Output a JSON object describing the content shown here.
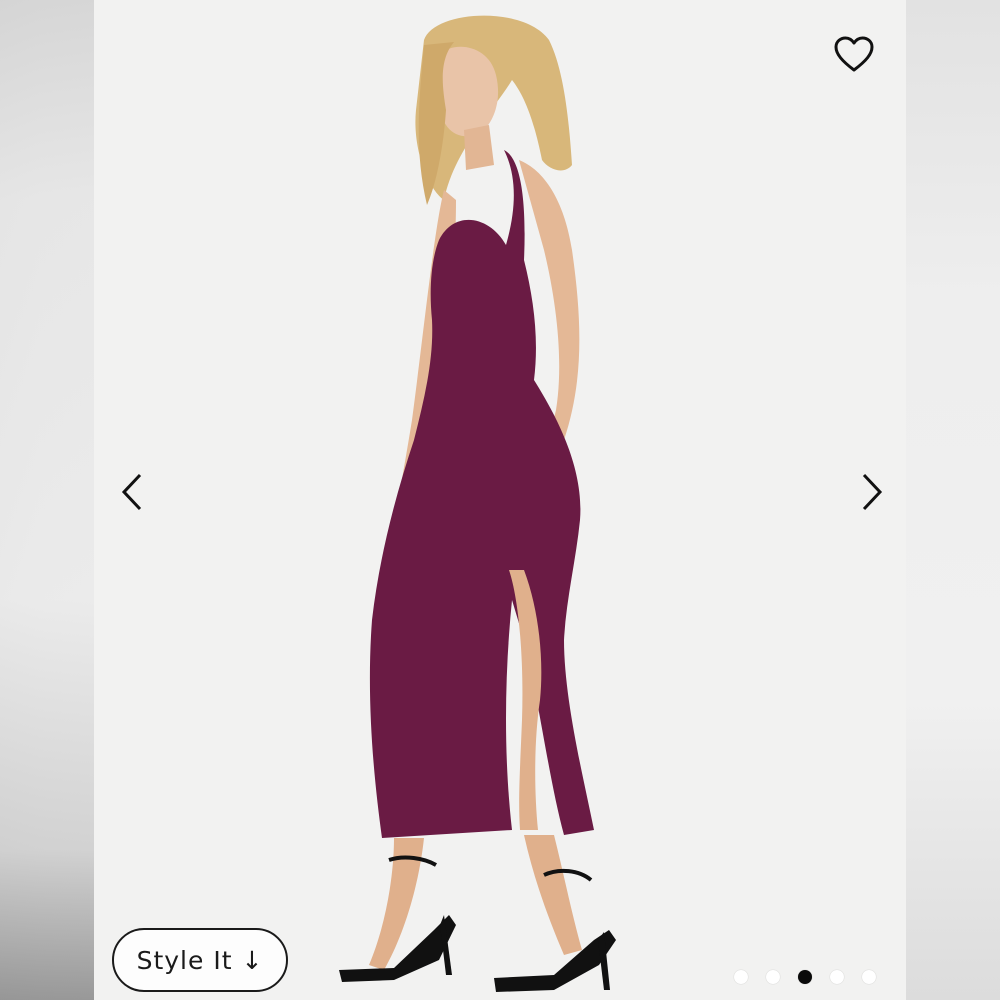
{
  "product": {
    "style_button_label": "Style It ↓",
    "dress_color": "#6a1b44"
  },
  "icons": {
    "favorite": "heart-icon",
    "prev": "chevron-left-icon",
    "next": "chevron-right-icon"
  },
  "carousel": {
    "slide_count": 5,
    "active_index": 2
  }
}
